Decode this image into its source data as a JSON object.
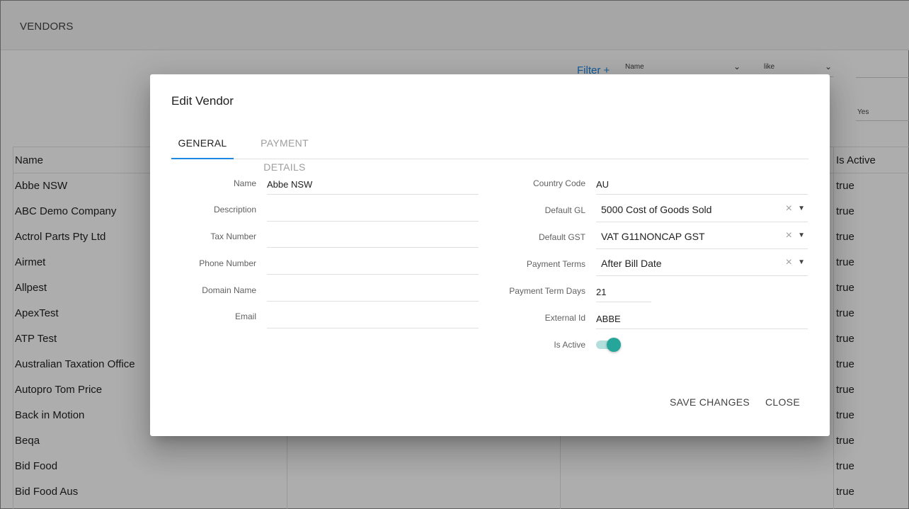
{
  "page": {
    "title": "VENDORS",
    "filter": {
      "link_label": "Filter +",
      "field_value": "Name",
      "operator_value": "like",
      "second_value": "Yes"
    },
    "grid": {
      "columns": [
        "Name",
        "Is Active"
      ],
      "rows": [
        {
          "name": "Abbe NSW",
          "active": "true"
        },
        {
          "name": "ABC Demo Company",
          "active": "true"
        },
        {
          "name": "Actrol Parts Pty Ltd",
          "active": "true"
        },
        {
          "name": "Airmet",
          "active": "true"
        },
        {
          "name": "Allpest",
          "active": "true"
        },
        {
          "name": "ApexTest",
          "active": "true"
        },
        {
          "name": "ATP Test",
          "active": "true"
        },
        {
          "name": "Australian Taxation Office",
          "active": "true"
        },
        {
          "name": "Autopro Tom Price",
          "active": "true"
        },
        {
          "name": "Back in Motion",
          "active": "true"
        },
        {
          "name": "Beqa",
          "active": "true"
        },
        {
          "name": "Bid Food",
          "active": "true"
        },
        {
          "name": "Bid Food Aus",
          "active": "true"
        }
      ]
    }
  },
  "dialog": {
    "title": "Edit Vendor",
    "tabs": {
      "general": "GENERAL",
      "payment": "PAYMENT DETAILS"
    },
    "left_fields": {
      "name": {
        "label": "Name",
        "value": "Abbe NSW"
      },
      "description": {
        "label": "Description",
        "value": ""
      },
      "tax_number": {
        "label": "Tax Number",
        "value": ""
      },
      "phone_number": {
        "label": "Phone Number",
        "value": ""
      },
      "domain_name": {
        "label": "Domain Name",
        "value": ""
      },
      "email": {
        "label": "Email",
        "value": ""
      }
    },
    "right_fields": {
      "country_code": {
        "label": "Country Code",
        "value": "AU"
      },
      "default_gl": {
        "label": "Default GL",
        "value": "5000 Cost of Goods Sold"
      },
      "default_gst": {
        "label": "Default GST",
        "value": "VAT G11NONCAP GST"
      },
      "payment_terms": {
        "label": "Payment Terms",
        "value": "After Bill Date"
      },
      "payment_term_days": {
        "label": "Payment Term Days",
        "value": "21"
      },
      "external_id": {
        "label": "External Id",
        "value": "ABBE"
      },
      "is_active": {
        "label": "Is Active",
        "value": true
      }
    },
    "buttons": {
      "save": "SAVE CHANGES",
      "close": "CLOSE"
    },
    "icons": {
      "clear": "×",
      "dropdown": "▼",
      "chevron": "⌄"
    }
  },
  "colors": {
    "accent": "#1e88e5",
    "toggle_on": "#26a69a"
  }
}
